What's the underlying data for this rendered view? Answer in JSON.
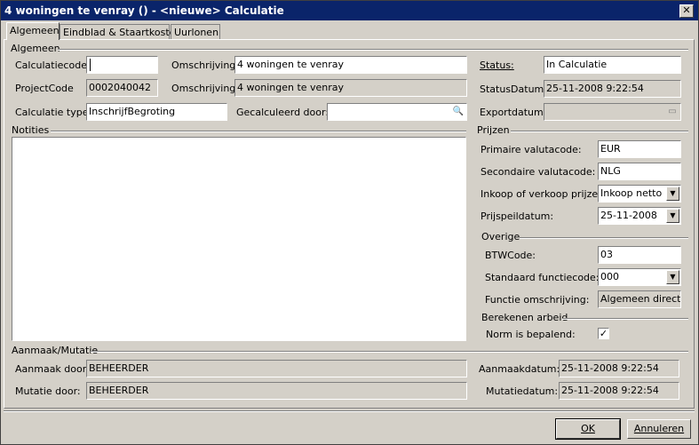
{
  "window": {
    "title": "4 woningen te venray () - <nieuwe> Calculatie",
    "close_glyph": "✕"
  },
  "tabs": [
    {
      "label": "Algemeen"
    },
    {
      "label": "Eindblad & Staartkosten"
    },
    {
      "label": "Uurlonen"
    }
  ],
  "algemeen": {
    "group_label": "Algemeen",
    "calculatiecode_label": "Calculatiecode:",
    "calculatiecode_value": "",
    "omschrijving1_label": "Omschrijving:",
    "omschrijving1_value": "4 woningen te venray",
    "status_label": "Status:",
    "status_value": "In Calculatie",
    "projectcode_label": "ProjectCode",
    "projectcode_value": "0002040042",
    "omschrijving2_label": "Omschrijving:",
    "omschrijving2_value": "4 woningen te venray",
    "statusdatum_label": "StatusDatum:",
    "statusdatum_value": "25-11-2008 9:22:54",
    "calculatietype_label": "Calculatie type:",
    "calculatietype_value": "InschrijfBegroting",
    "gecalculeerd_label": "Gecalculeerd door:",
    "gecalculeerd_value": "",
    "exportdatum_label": "Exportdatum:",
    "exportdatum_value": ""
  },
  "notities": {
    "label": "Notities"
  },
  "prijzen": {
    "group_label": "Prijzen",
    "primaire_label": "Primaire valutacode:",
    "primaire_value": "EUR",
    "secondaire_label": "Secondaire valutacode:",
    "secondaire_value": "NLG",
    "inkoop_label": "Inkoop of verkoop prijzen:",
    "inkoop_value": "Inkoop netto",
    "prijspeil_label": "Prijspeildatum:",
    "prijspeil_value": "25-11-2008"
  },
  "overige": {
    "group_label": "Overige",
    "btw_label": "BTWCode:",
    "btw_value": "03",
    "functiecode_label": "Standaard functiecode:",
    "functiecode_value": "000",
    "functieoms_label": "Functie omschrijving:",
    "functieoms_value": "Algemeen directeu"
  },
  "berekenen": {
    "group_label": "Berekenen arbeid",
    "norm_label": "Norm is bepalend:",
    "norm_checked": "✓"
  },
  "mutatie": {
    "group_label": "Aanmaak/Mutatie",
    "aanmaak_door_label": "Aanmaak door:",
    "aanmaak_door_value": "BEHEERDER",
    "aanmaakdatum_label": "Aanmaakdatum:",
    "aanmaakdatum_value": "25-11-2008 9:22:54",
    "mutatie_door_label": "Mutatie door:",
    "mutatie_door_value": "BEHEERDER",
    "mutatiedatum_label": "Mutatiedatum:",
    "mutatiedatum_value": "25-11-2008 9:22:54"
  },
  "buttons": {
    "ok": "OK",
    "cancel": "Annuleren"
  },
  "icons": {
    "dropdown": "▼",
    "lookup": "🔍",
    "calendar": "▭"
  }
}
